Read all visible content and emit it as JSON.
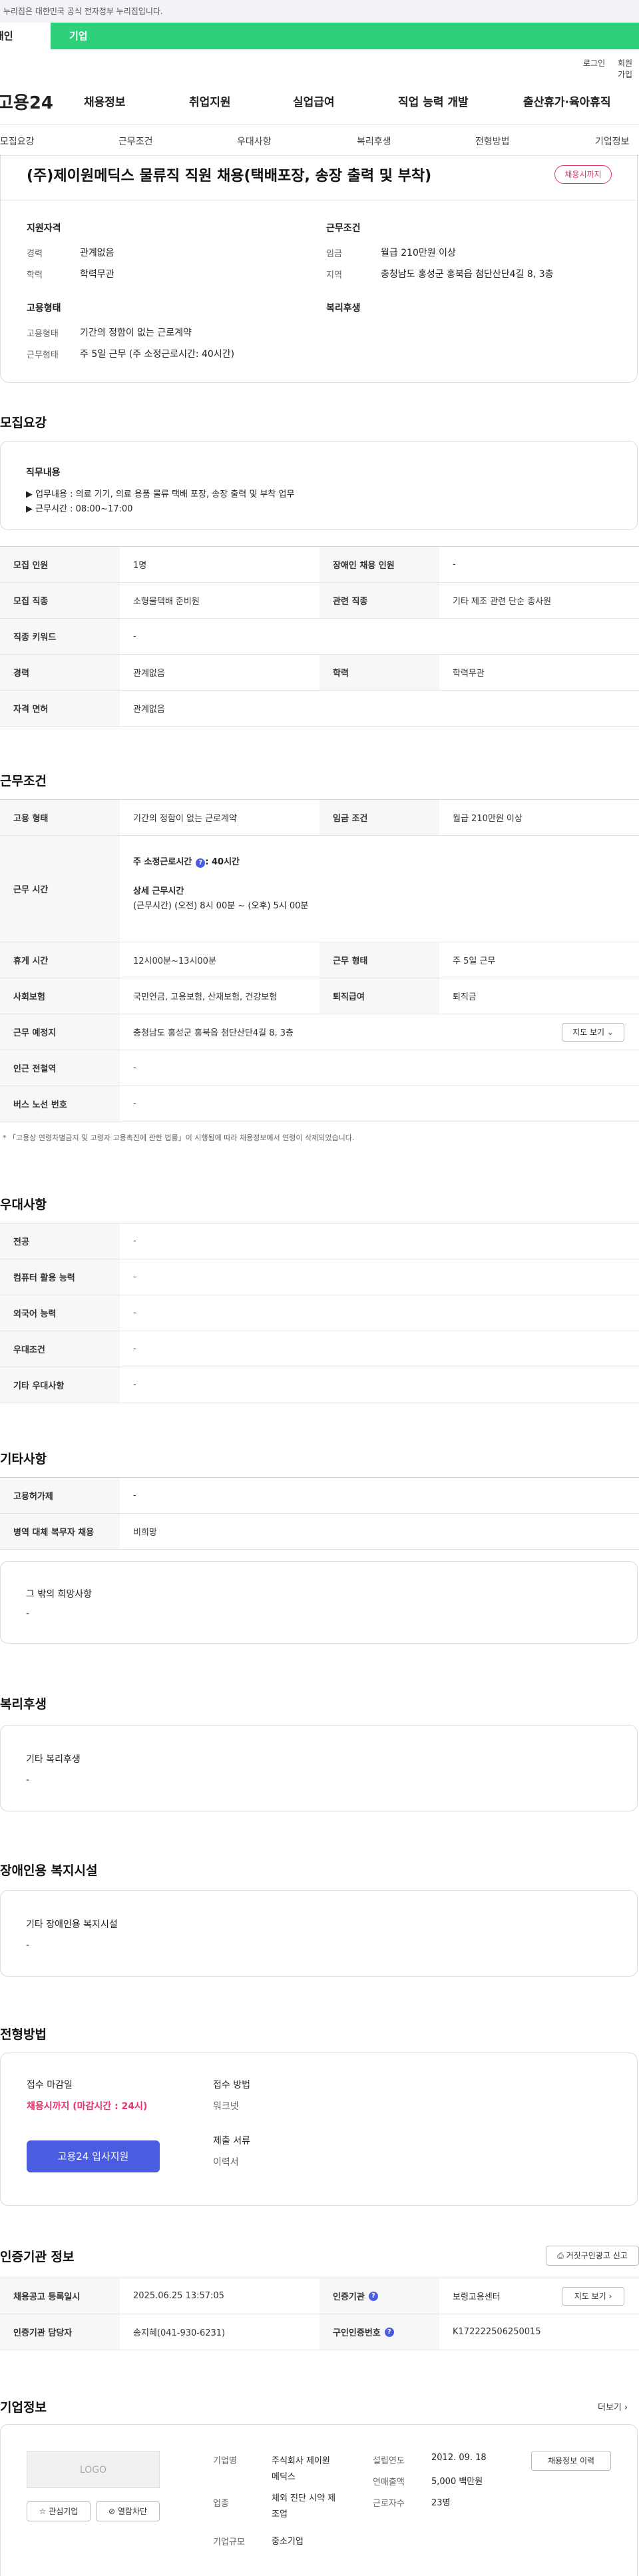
{
  "gov_banner": "이 누리집은 대한민국 공식 전자정부 누리집입니다.",
  "user_tabs": {
    "personal": "개인",
    "corporate": "기업"
  },
  "util": {
    "login": "로그인",
    "join": "회원가입"
  },
  "brand": {
    "logo": "고용24"
  },
  "gnb": [
    "채용정보",
    "취업지원",
    "실업급여",
    "직업 능력 개발",
    "출산휴가·육아휴직"
  ],
  "anchors": [
    "모집요강",
    "근무조건",
    "우대사항",
    "복리후생",
    "전형방법",
    "기업정보"
  ],
  "job": {
    "title": "(주)제이원메딕스 물류직 직원 채용(택배포장, 송장 출력 및 부착)",
    "status_badge": "채용시까지"
  },
  "summary": {
    "qual_title": "지원자격",
    "career_label": "경력",
    "career": "관계없음",
    "edu_label": "학력",
    "edu": "학력무관",
    "cond_title": "근무조건",
    "wage_label": "임금",
    "wage": "월급 210만원 이상",
    "region_label": "지역",
    "region": "충청남도 홍성군 홍북읍 첨단산단4길 8, 3층",
    "emp_title": "고용형태",
    "emptype_label": "고용형태",
    "emptype": "기간의 정함이 없는 근로계약",
    "workform_label": "근무형태",
    "workform": "주 5일 근무 (주 소정근로시간: 40시간)",
    "welfare_title": "복리후생"
  },
  "recruit": {
    "section": "모집요강",
    "duty_title": "직무내용",
    "duty_lines": [
      "▶ 업무내용 : 의료 기기, 의료 용품 물류 택배 포장, 송장 출력 및 부착 업무",
      "▶ 근무시간 : 08:00~17:00"
    ],
    "rows": [
      {
        "th1": "모집 인원",
        "td1": "1명",
        "th2": "장애인 채용 인원",
        "td2": "-"
      },
      {
        "th1": "모집 직종",
        "td1": "소형물택배 준비원",
        "th2": "관련 직종",
        "td2": "기타 제조 관련 단순 종사원"
      },
      {
        "th1": "직종 키워드",
        "td1": "-"
      },
      {
        "th1": "경력",
        "td1": "관계없음",
        "th2": "학력",
        "td2": "학력무관"
      },
      {
        "th1": "자격 면허",
        "td1": "관계없음"
      }
    ]
  },
  "work": {
    "section": "근무조건",
    "emp_th": "고용 형태",
    "emp_td": "기간의 정함이 없는 근로계약",
    "wage_th": "임금 조건",
    "wage_td": "월급 210만원 이상",
    "hours_th": "근무 시간",
    "hours_main": "주 소정근로시간",
    "hours_main_val": ": 40시간",
    "hours_detail_title": "상세 근무시간",
    "hours_detail": "(근무시간) (오전) 8시 00분 ~ (오후) 5시 00분",
    "break_th": "휴게 시간",
    "break_td": "12시00분~13시00분",
    "form_th": "근무 형태",
    "form_td": "주 5일 근무",
    "ins_th": "사회보험",
    "ins_td": "국민연금, 고용보험, 산재보험, 건강보험",
    "ret_th": "퇴직급여",
    "ret_td": "퇴직금",
    "place_th": "근무 예정지",
    "place_td": "충청남도 홍성군 홍북읍 첨단산단4길 8, 3층",
    "map_btn": "지도 보기",
    "subway_th": "인근 전철역",
    "subway_td": "-",
    "bus_th": "버스 노선 번호",
    "bus_td": "-",
    "note": "* 「고용상 연령차별금지 및 고령자 고용촉진에 관한 법률」이 시행됨에 따라 채용정보에서 연령이 삭제되었습니다."
  },
  "pref": {
    "section": "우대사항",
    "rows": [
      {
        "th": "전공",
        "td": "-"
      },
      {
        "th": "컴퓨터 활용 능력",
        "td": "-"
      },
      {
        "th": "외국어 능력",
        "td": "-"
      },
      {
        "th": "우대조건",
        "td": "-"
      },
      {
        "th": "기타 우대사항",
        "td": "-"
      }
    ]
  },
  "etc": {
    "section": "기타사항",
    "rows": [
      {
        "th": "고용허가제",
        "td": "-"
      },
      {
        "th": "병역 대체 복무자 채용",
        "td": "비희망"
      }
    ],
    "other_title": "그 밖의 희망사항",
    "other_val": "-"
  },
  "welfare": {
    "section": "복리후생",
    "title": "기타 복리후생",
    "val": "-"
  },
  "disabled": {
    "section": "장애인용 복지시설",
    "title": "기타 장애인용 복지시설",
    "val": "-"
  },
  "process": {
    "section": "전형방법",
    "deadline_title": "접수 마감일",
    "deadline": "채용시까지 (마감시간 : 24시)",
    "method_title": "접수 방법",
    "method": "워크넷",
    "docs_title": "제출 서류",
    "docs": "이력서",
    "apply_btn": "고용24 입사지원"
  },
  "cert": {
    "section": "인증기관 정보",
    "report_btn": "거짓구인광고 신고",
    "date_th": "채용공고 등록일시",
    "date_td": "2025.06.25 13:57:05",
    "agency_th": "인증기관",
    "agency_td": "보령고용센터",
    "map_btn": "지도 보기",
    "manager_th": "인증기관 담당자",
    "manager_td": "송지혜(041-930-6231)",
    "auth_th": "구인인증번호",
    "auth_td": "K172222506250015"
  },
  "company": {
    "section": "기업정보",
    "more": "더보기",
    "logo": "LOGO",
    "fav_btn": "관심기업",
    "block_btn": "열람차단",
    "name_label": "기업명",
    "name": "주식회사 제이원\n메딕스",
    "industry_label": "업종",
    "industry": "체외 진단 시약 제\n조업",
    "size_label": "기업규모",
    "size": "중소기업",
    "found_label": "설립연도",
    "found": "2012. 09. 18",
    "sales_label": "연매출액",
    "sales": "5,000 백만원",
    "emp_label": "근로자수",
    "emp": "23명",
    "history_btn": "채용정보 이력"
  }
}
